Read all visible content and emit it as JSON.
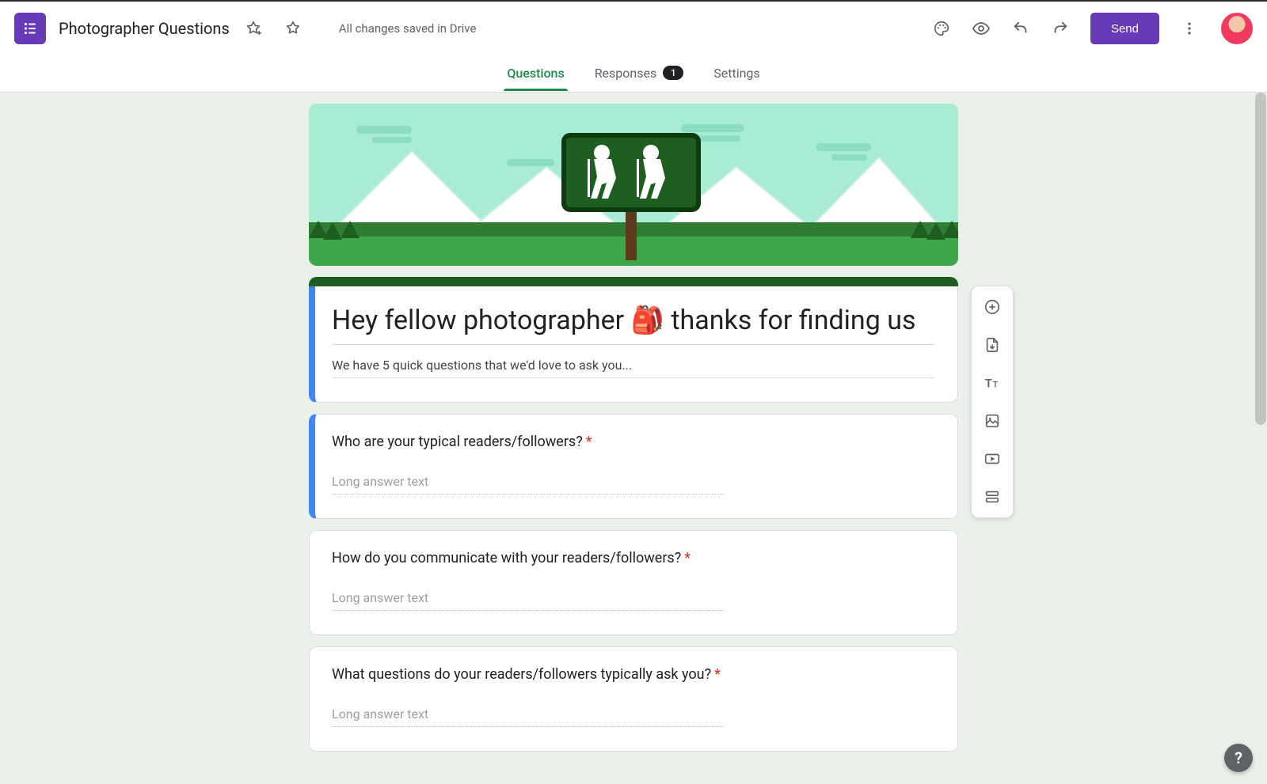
{
  "header": {
    "doc_title": "Photographer Questions",
    "saved_text": "All changes saved in Drive",
    "send_label": "Send"
  },
  "tabs": {
    "questions": "Questions",
    "responses": "Responses",
    "responses_count": "1",
    "settings": "Settings"
  },
  "form": {
    "title": "Hey fellow photographer 🎒 thanks for finding us",
    "description": "We have 5 quick questions that we'd love to ask you...",
    "questions": [
      {
        "text": "Who are your typical readers/followers?",
        "required": true,
        "answer_placeholder": "Long answer text",
        "selected": true
      },
      {
        "text": "How do you communicate with your readers/followers?",
        "required": true,
        "answer_placeholder": "Long answer text",
        "selected": false
      },
      {
        "text": "What questions do your readers/followers typically ask you?",
        "required": true,
        "answer_placeholder": "Long answer text",
        "selected": false
      }
    ]
  },
  "side_toolbar": {
    "items": [
      "add-question",
      "import-questions",
      "add-title-description",
      "add-image",
      "add-video",
      "add-section"
    ]
  },
  "help_label": "?"
}
